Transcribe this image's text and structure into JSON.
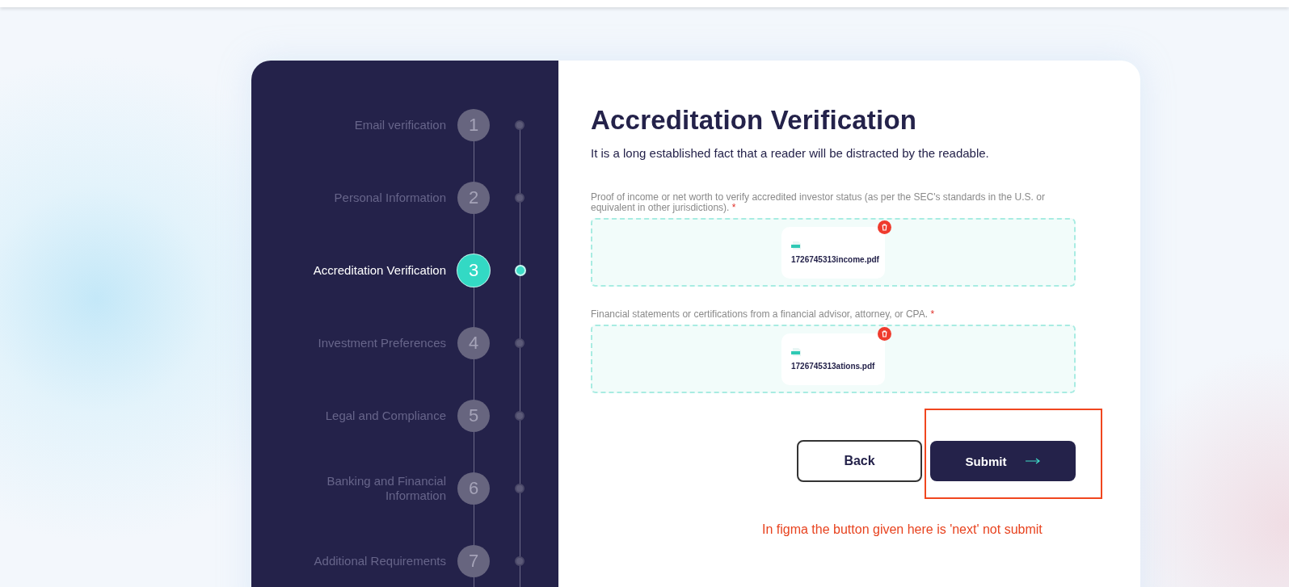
{
  "steps": [
    {
      "label": "Email verification",
      "number": "1",
      "selected": false
    },
    {
      "label": "Personal Information",
      "number": "2",
      "selected": false
    },
    {
      "label": "Accreditation Verification",
      "number": "3",
      "selected": true
    },
    {
      "label": "Investment Preferences",
      "number": "4",
      "selected": false
    },
    {
      "label": "Legal and Compliance",
      "number": "5",
      "selected": false
    },
    {
      "label": "Banking and Financial Information",
      "number": "6",
      "selected": false
    },
    {
      "label": "Additional Requirements",
      "number": "7",
      "selected": false
    }
  ],
  "title": "Accreditation Verification",
  "subtitle": "It is a long established fact that a reader will be distracted by the readable.",
  "uploads": [
    {
      "label": "Proof of income or net worth to verify accredited investor status (as per the SEC's standards in the U.S. or equivalent in other jurisdictions).",
      "required_mark": "*",
      "file_name": "1726745313income.pdf"
    },
    {
      "label": "Financial statements or certifications from a financial advisor, attorney, or CPA.",
      "required_mark": "*",
      "file_name": "1726745313ations.pdf"
    }
  ],
  "back_button": "Back",
  "submit_button": "Submit",
  "annotation_note": "In figma the button given here is 'next' not submit"
}
